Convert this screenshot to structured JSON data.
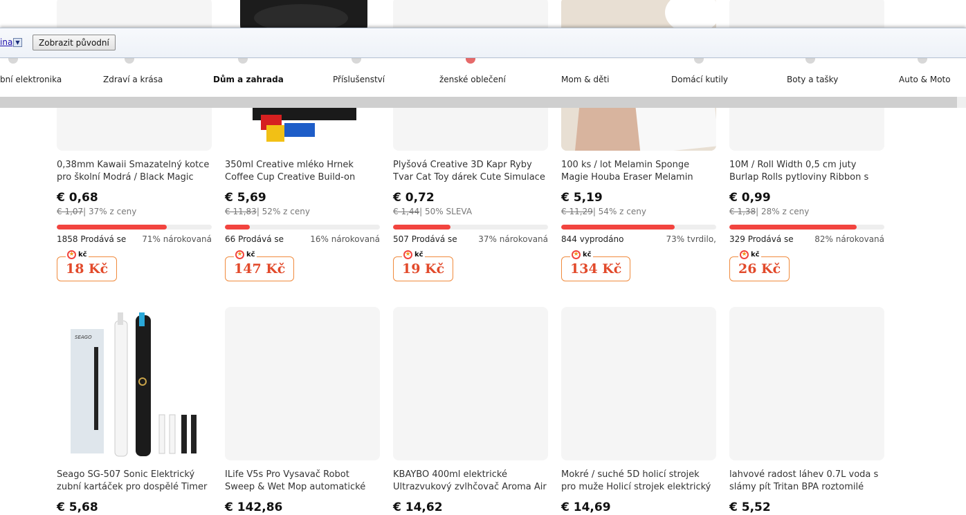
{
  "translate_bar": {
    "language_link": "ina",
    "show_original_label": "Zobrazit původní"
  },
  "categories": [
    {
      "label": "bní elektronika",
      "active": false
    },
    {
      "label": "Zdraví a krása",
      "active": false
    },
    {
      "label": "Dům a zahrada",
      "active": true
    },
    {
      "label": "Příslušenství",
      "active": false
    },
    {
      "label": "ženské oblečení",
      "active": false
    },
    {
      "label": "Mom & děti",
      "active": false
    },
    {
      "label": "Domácí kutily",
      "active": false
    },
    {
      "label": "Boty a tašky",
      "active": false
    },
    {
      "label": "Auto & Moto",
      "active": false
    }
  ],
  "products_row1": [
    {
      "title": "0,38mm Kawaii Smazatelný kotce pro školní Modrá / Black Magic",
      "price": "€ 0,68",
      "orig": "€ 1,07",
      "discount": "| 37% z ceny",
      "progress": 0.71,
      "sold": "1858 Prodává se",
      "claimed": "71% nárokovaná",
      "coins": "18 Kč"
    },
    {
      "title": "350ml Creative mléko Hrnek Coffee Cup Creative Build-on Brick Hrnek",
      "price": "€ 5,69",
      "orig": "€ 11,83",
      "discount": "| 52% z ceny",
      "progress": 0.16,
      "sold": "66 Prodává se",
      "claimed": "16% nárokovaná",
      "coins": "147 Kč"
    },
    {
      "title": "Plyšová Creative 3D Kapr Ryby Tvar Cat Toy dárek Cute Simulace Ryby",
      "price": "€ 0,72",
      "orig": "€ 1,44",
      "discount": "| 50% SLEVA",
      "progress": 0.37,
      "sold": "507 Prodává se",
      "claimed": "37% nárokovaná",
      "coins": "19 Kč"
    },
    {
      "title": "100 ks / lot Melamin Sponge Magie Houba Eraser Melamin Cleaner pro",
      "price": "€ 5,19",
      "orig": "€ 11,29",
      "discount": "| 54% z ceny",
      "progress": 0.73,
      "sold": "844 vyprodáno",
      "claimed": "73% tvrdilo,",
      "coins": "134 Kč"
    },
    {
      "title": "10M / Roll Width 0,5 cm juty Burlap Rolls pytloviny Ribbon s krajkou",
      "price": "€ 0,99",
      "orig": "€ 1,38",
      "discount": "| 28% z ceny",
      "progress": 0.82,
      "sold": "329 Prodává se",
      "claimed": "82% nárokovaná",
      "coins": "26 Kč"
    }
  ],
  "products_row2": [
    {
      "title": "Seago SG-507 Sonic Elektrický zubní kartáček pro dospělé Timer Brush",
      "price": "€ 5,68"
    },
    {
      "title": "ILife V5s Pro Vysavač Robot Sweep & Wet Mop automatické dobíjení k Pet",
      "price": "€ 142,86"
    },
    {
      "title": "KBAYBO 400ml elektrické Ultrazvukový zvlhčovač Aroma Air",
      "price": "€ 14,62"
    },
    {
      "title": "Mokré / suché 5D holicí strojek pro muže Holicí strojek elektrický holicí",
      "price": "€ 14,69"
    },
    {
      "title": "lahvové radost láhev 0.7L voda s slámy pít Tritan BPA roztomilé vodní",
      "price": "€ 5,52"
    }
  ],
  "coin_unit": "kč",
  "toothbrush_box_brand": "SEAGO"
}
